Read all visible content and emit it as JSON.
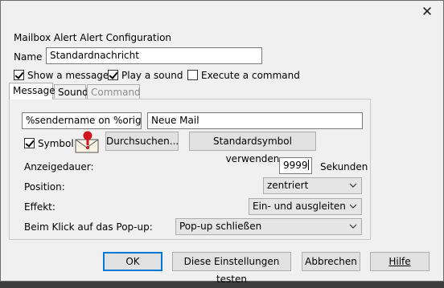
{
  "window": {
    "close_glyph": "✕"
  },
  "header": {
    "title": "Mailbox Alert Alert Configuration",
    "name_label": "Name",
    "name_value": "Standardnachricht"
  },
  "options": {
    "show_message": {
      "label": "Show a message",
      "checked": true
    },
    "play_sound": {
      "label": "Play a sound",
      "checked": true
    },
    "execute_command": {
      "label": "Execute a command",
      "checked": false
    }
  },
  "tabs": [
    {
      "label": "Message",
      "active": true,
      "disabled": false
    },
    {
      "label": "Sound",
      "active": false,
      "disabled": false
    },
    {
      "label": "Command",
      "active": false,
      "disabled": true
    }
  ],
  "message": {
    "subject_value": "%sendername on %origina",
    "text_value": "Neue Mail",
    "symbol_label": "Symbol",
    "symbol_checked": true,
    "browse_label": "Durchsuchen...",
    "default_symbol_label": "Standardsymbol verwenden",
    "duration_label": "Anzeigedauer:",
    "duration_value": "9999",
    "duration_unit": "Sekunden",
    "position_label": "Position:",
    "position_value": "zentriert",
    "effect_label": "Effekt:",
    "effect_value": "Ein- und ausgleiten",
    "click_label": "Beim Klick auf das Pop-up:",
    "click_value": "Pop-up schließen"
  },
  "footer": {
    "ok_label": "OK",
    "test_label": "Diese Einstellungen testen",
    "cancel_label": "Abbrechen",
    "help_label": "Hilfe"
  },
  "colors": {
    "focus_border": "#0078d7",
    "dialog_bg": "#f0f0f0",
    "icon_red": "#d2141c"
  }
}
